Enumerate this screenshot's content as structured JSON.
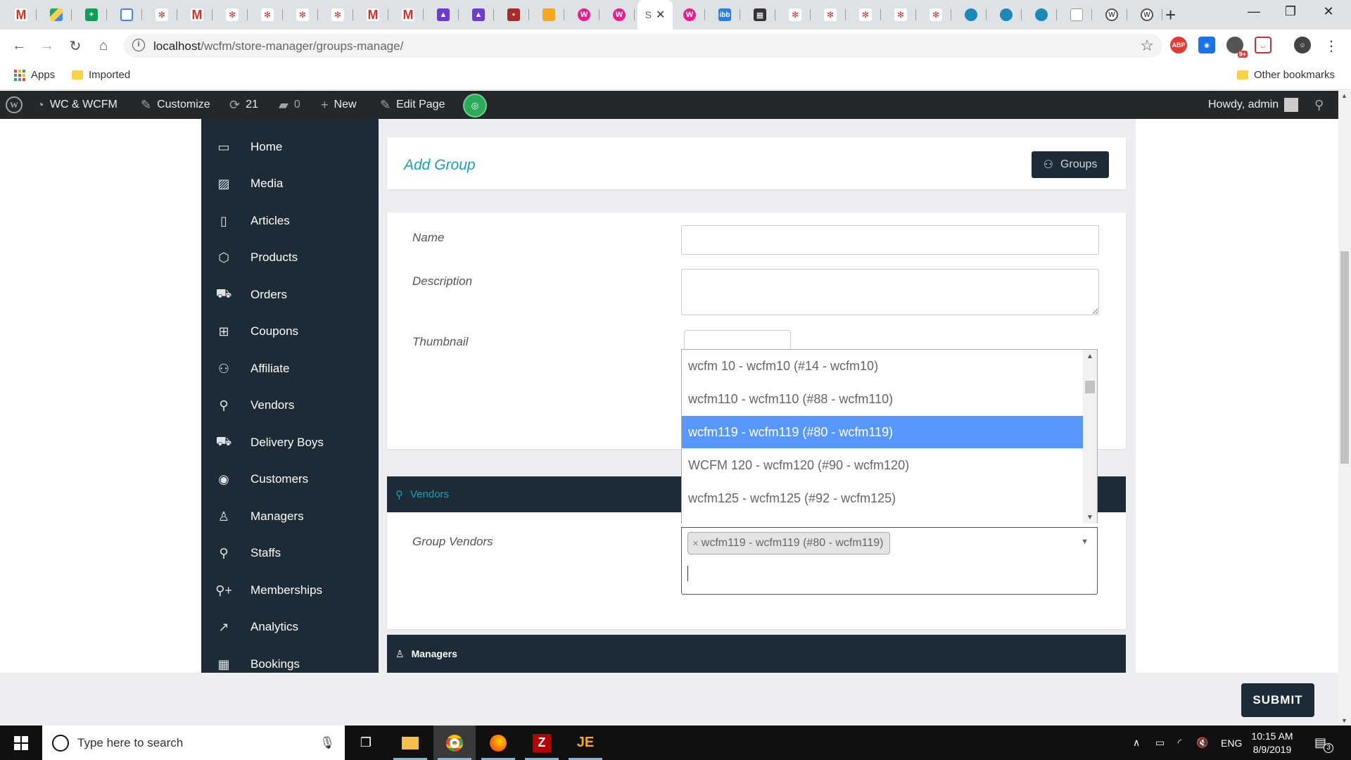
{
  "browser": {
    "active_tab_label": "S",
    "address": {
      "host": "localhost",
      "path": "/wcfm/store-manager/groups-manage/"
    },
    "extension_labels": {
      "adblock": "ABP",
      "badge": "9+"
    },
    "bookmarks": {
      "apps": "Apps",
      "imported": "Imported",
      "other": "Other bookmarks"
    }
  },
  "admin_bar": {
    "site_name": "WC & WCFM",
    "customize": "Customize",
    "updates_count": "21",
    "comments_count": "0",
    "new_label": "New",
    "edit_page": "Edit Page",
    "greeting": "Howdy, admin"
  },
  "sidebar": {
    "items": [
      {
        "label": "Home",
        "icon": "monitor-icon"
      },
      {
        "label": "Media",
        "icon": "image-icon"
      },
      {
        "label": "Articles",
        "icon": "document-icon"
      },
      {
        "label": "Products",
        "icon": "cube-icon"
      },
      {
        "label": "Orders",
        "icon": "cart-icon"
      },
      {
        "label": "Coupons",
        "icon": "gift-icon"
      },
      {
        "label": "Affiliate",
        "icon": "users-icon"
      },
      {
        "label": "Vendors",
        "icon": "user-icon"
      },
      {
        "label": "Delivery Boys",
        "icon": "truck-icon"
      },
      {
        "label": "Customers",
        "icon": "user-circle-icon"
      },
      {
        "label": "Managers",
        "icon": "user-tie-icon"
      },
      {
        "label": "Staffs",
        "icon": "user-icon"
      },
      {
        "label": "Memberships",
        "icon": "user-plus-icon"
      },
      {
        "label": "Analytics",
        "icon": "chart-line-icon"
      },
      {
        "label": "Bookings",
        "icon": "calendar-icon"
      }
    ]
  },
  "header": {
    "title": "Add Group",
    "groups_button": "Groups"
  },
  "form": {
    "name_label": "Name",
    "name_value": "",
    "description_label": "Description",
    "description_value": "",
    "thumbnail_label": "Thumbnail"
  },
  "vendors_section": {
    "title": "Vendors",
    "group_vendors_label": "Group Vendors",
    "dropdown_options": [
      "wcfm 10 - wcfm10 (#14 - wcfm10)",
      "wcfm110 - wcfm110 (#88 - wcfm110)",
      "wcfm119 - wcfm119 (#80 - wcfm119)",
      "WCFM 120 - wcfm120 (#90 - wcfm120)",
      "wcfm125 - wcfm125 (#92 - wcfm125)"
    ],
    "highlighted_option": "wcfm119 - wcfm119 (#80 - wcfm119)",
    "selected_chip": "wcfm119 - wcfm119 (#80 - wcfm119)",
    "chip_remove": "×"
  },
  "managers_section": {
    "title": "Managers"
  },
  "footer": {
    "submit_label": "SUBMIT"
  },
  "taskbar": {
    "search_placeholder": "Type here to search",
    "language": "ENG",
    "time": "10:15 AM",
    "date": "8/9/2019",
    "notifications": "3"
  },
  "colors": {
    "sidebar": "#1c2b36",
    "accent": "#17a2b8",
    "highlight": "#5897fb",
    "page_bg": "#eceef1",
    "admin_bar": "#23282d"
  }
}
